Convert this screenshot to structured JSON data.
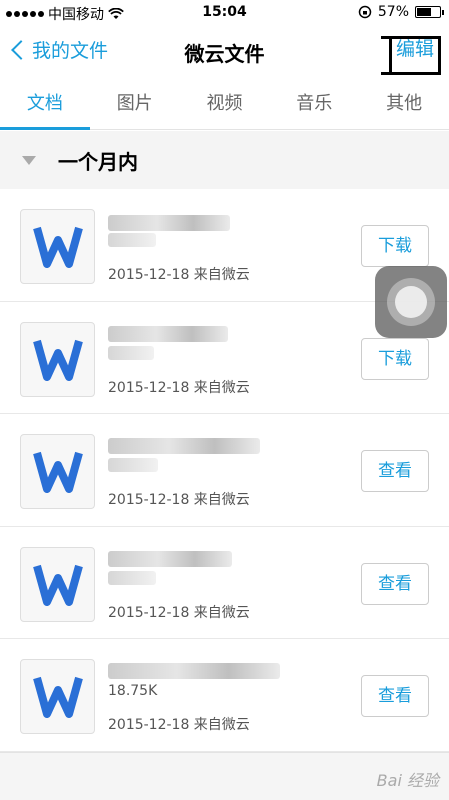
{
  "status": {
    "carrier": "中国移动",
    "time": "15:04",
    "battery": "57%",
    "battery_level": 0.57
  },
  "nav": {
    "back_label": "我的文件",
    "title": "微云文件",
    "edit_label": "编辑"
  },
  "tabs": [
    {
      "label": "文档",
      "active": true
    },
    {
      "label": "图片",
      "active": false
    },
    {
      "label": "视频",
      "active": false
    },
    {
      "label": "音乐",
      "active": false
    },
    {
      "label": "其他",
      "active": false
    }
  ],
  "section": {
    "title": "一个月内"
  },
  "files": [
    {
      "size": "",
      "date": "2015-12-18 来自微云",
      "action": "下载"
    },
    {
      "size": "",
      "date": "2015-12-18 来自微云",
      "action": "下载"
    },
    {
      "size": "",
      "date": "2015-12-18 来自微云",
      "action": "查看"
    },
    {
      "size": "",
      "date": "2015-12-18 来自微云",
      "action": "查看"
    },
    {
      "size": "18.75K",
      "date": "2015-12-18 来自微云",
      "action": "查看"
    }
  ],
  "watermark": "Bai 经验",
  "icons": {
    "file_type": "word-doc-icon",
    "back": "chevron-left-icon",
    "assistive": "assistive-touch-icon",
    "section_toggle": "triangle-down-icon"
  },
  "colors": {
    "accent": "#1a9ddb",
    "doc_icon": "#2a6fd6"
  }
}
